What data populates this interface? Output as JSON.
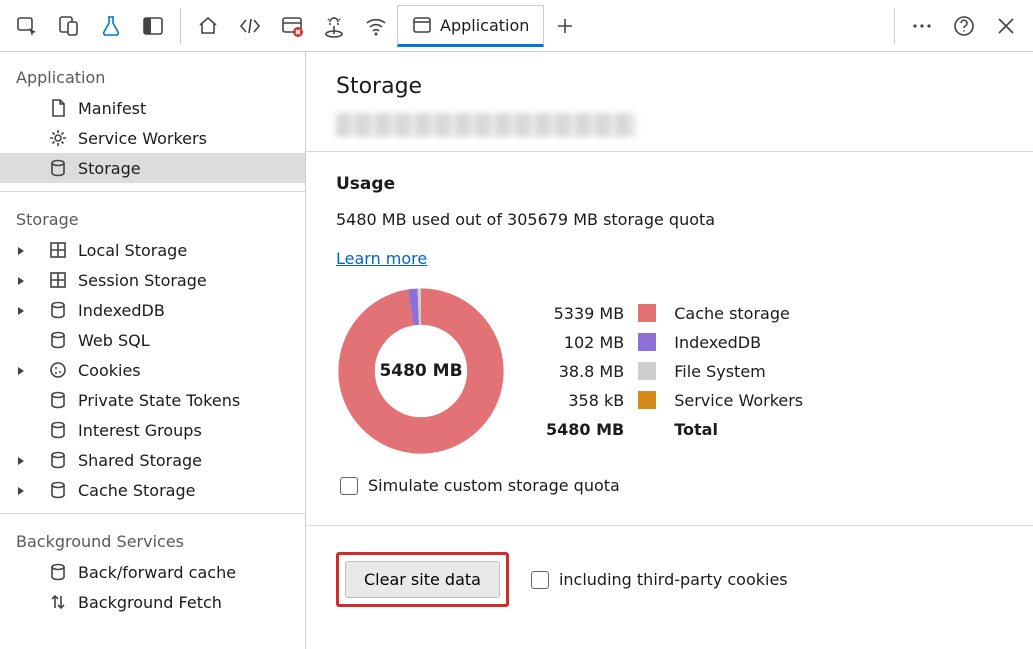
{
  "toolbar": {
    "tab_label": "Application"
  },
  "sidebar": {
    "sections": {
      "application": {
        "title": "Application",
        "items": [
          {
            "label": "Manifest"
          },
          {
            "label": "Service Workers"
          },
          {
            "label": "Storage"
          }
        ]
      },
      "storage": {
        "title": "Storage",
        "items": [
          {
            "label": "Local Storage"
          },
          {
            "label": "Session Storage"
          },
          {
            "label": "IndexedDB"
          },
          {
            "label": "Web SQL"
          },
          {
            "label": "Cookies"
          },
          {
            "label": "Private State Tokens"
          },
          {
            "label": "Interest Groups"
          },
          {
            "label": "Shared Storage"
          },
          {
            "label": "Cache Storage"
          }
        ]
      },
      "background": {
        "title": "Background Services",
        "items": [
          {
            "label": "Back/forward cache"
          },
          {
            "label": "Background Fetch"
          }
        ]
      }
    }
  },
  "main": {
    "heading": "Storage",
    "usage_heading": "Usage",
    "usage_text": "5480 MB used out of 305679 MB storage quota",
    "learn_more": "Learn more",
    "donut_center": "5480 MB",
    "legend": [
      {
        "value": "5339 MB",
        "name": "Cache storage",
        "color": "#e27275"
      },
      {
        "value": "102 MB",
        "name": "IndexedDB",
        "color": "#8d70d6"
      },
      {
        "value": "38.8 MB",
        "name": "File System",
        "color": "#cfcfcf"
      },
      {
        "value": "358 kB",
        "name": "Service Workers",
        "color": "#d68a1c"
      }
    ],
    "total_value": "5480 MB",
    "total_label": "Total",
    "simulate_label": "Simulate custom storage quota",
    "clear_button": "Clear site data",
    "third_party_label": "including third-party cookies"
  },
  "chart_data": {
    "type": "pie",
    "title": "Storage usage",
    "unit": "MB",
    "total": 5480,
    "series": [
      {
        "name": "Cache storage",
        "value": 5339,
        "color": "#e27275"
      },
      {
        "name": "IndexedDB",
        "value": 102,
        "color": "#8d70d6"
      },
      {
        "name": "File System",
        "value": 38.8,
        "color": "#cfcfcf"
      },
      {
        "name": "Service Workers",
        "value": 0.358,
        "color": "#d68a1c"
      }
    ]
  }
}
